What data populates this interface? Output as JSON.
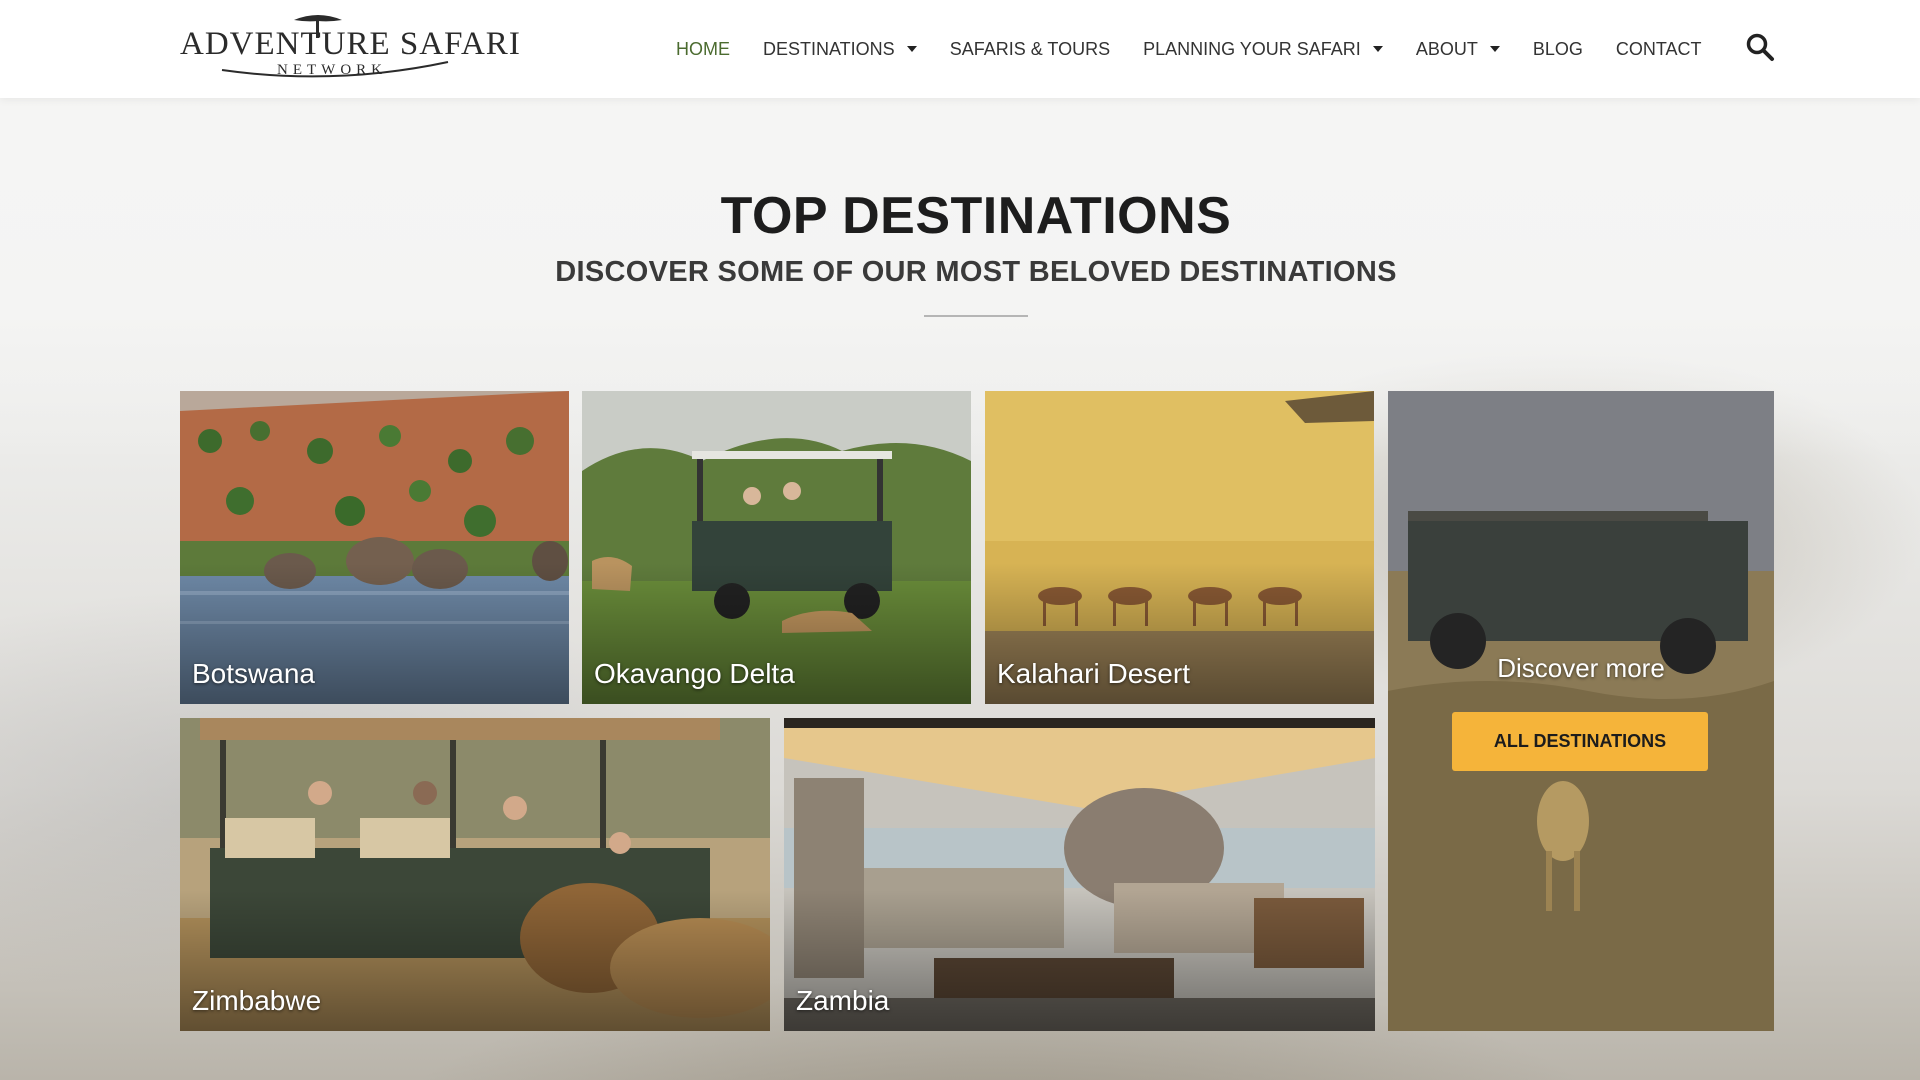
{
  "brand": {
    "name": "ADVENTURE SAFARI",
    "subname": "NETWORK"
  },
  "nav": {
    "items": [
      {
        "label": "HOME",
        "active": true,
        "dropdown": false
      },
      {
        "label": "DESTINATIONS",
        "active": false,
        "dropdown": true
      },
      {
        "label": "SAFARIS & TOURS",
        "active": false,
        "dropdown": false
      },
      {
        "label": "PLANNING YOUR SAFARI",
        "active": false,
        "dropdown": true
      },
      {
        "label": "ABOUT",
        "active": false,
        "dropdown": true
      },
      {
        "label": "BLOG",
        "active": false,
        "dropdown": false
      },
      {
        "label": "CONTACT",
        "active": false,
        "dropdown": false
      }
    ],
    "search_icon": "search-icon"
  },
  "section": {
    "title": "TOP DESTINATIONS",
    "subtitle": "DISCOVER SOME OF OUR MOST BELOVED DESTINATIONS"
  },
  "destinations": [
    {
      "label": "Botswana",
      "scene": "elephants-at-river"
    },
    {
      "label": "Okavango Delta",
      "scene": "safari-jeep-with-lioness"
    },
    {
      "label": "Kalahari Desert",
      "scene": "springbok-in-grassland"
    },
    {
      "label": "Zimbabwe",
      "scene": "game-drive-with-lion"
    },
    {
      "label": "Zambia",
      "scene": "lodge-deck-with-elephant"
    }
  ],
  "discover": {
    "label": "Discover more",
    "button": "ALL DESTINATIONS"
  },
  "colors": {
    "accent_button": "#f5b43a",
    "nav_active": "#4b6b2f",
    "header_bg": "#ffffff"
  }
}
